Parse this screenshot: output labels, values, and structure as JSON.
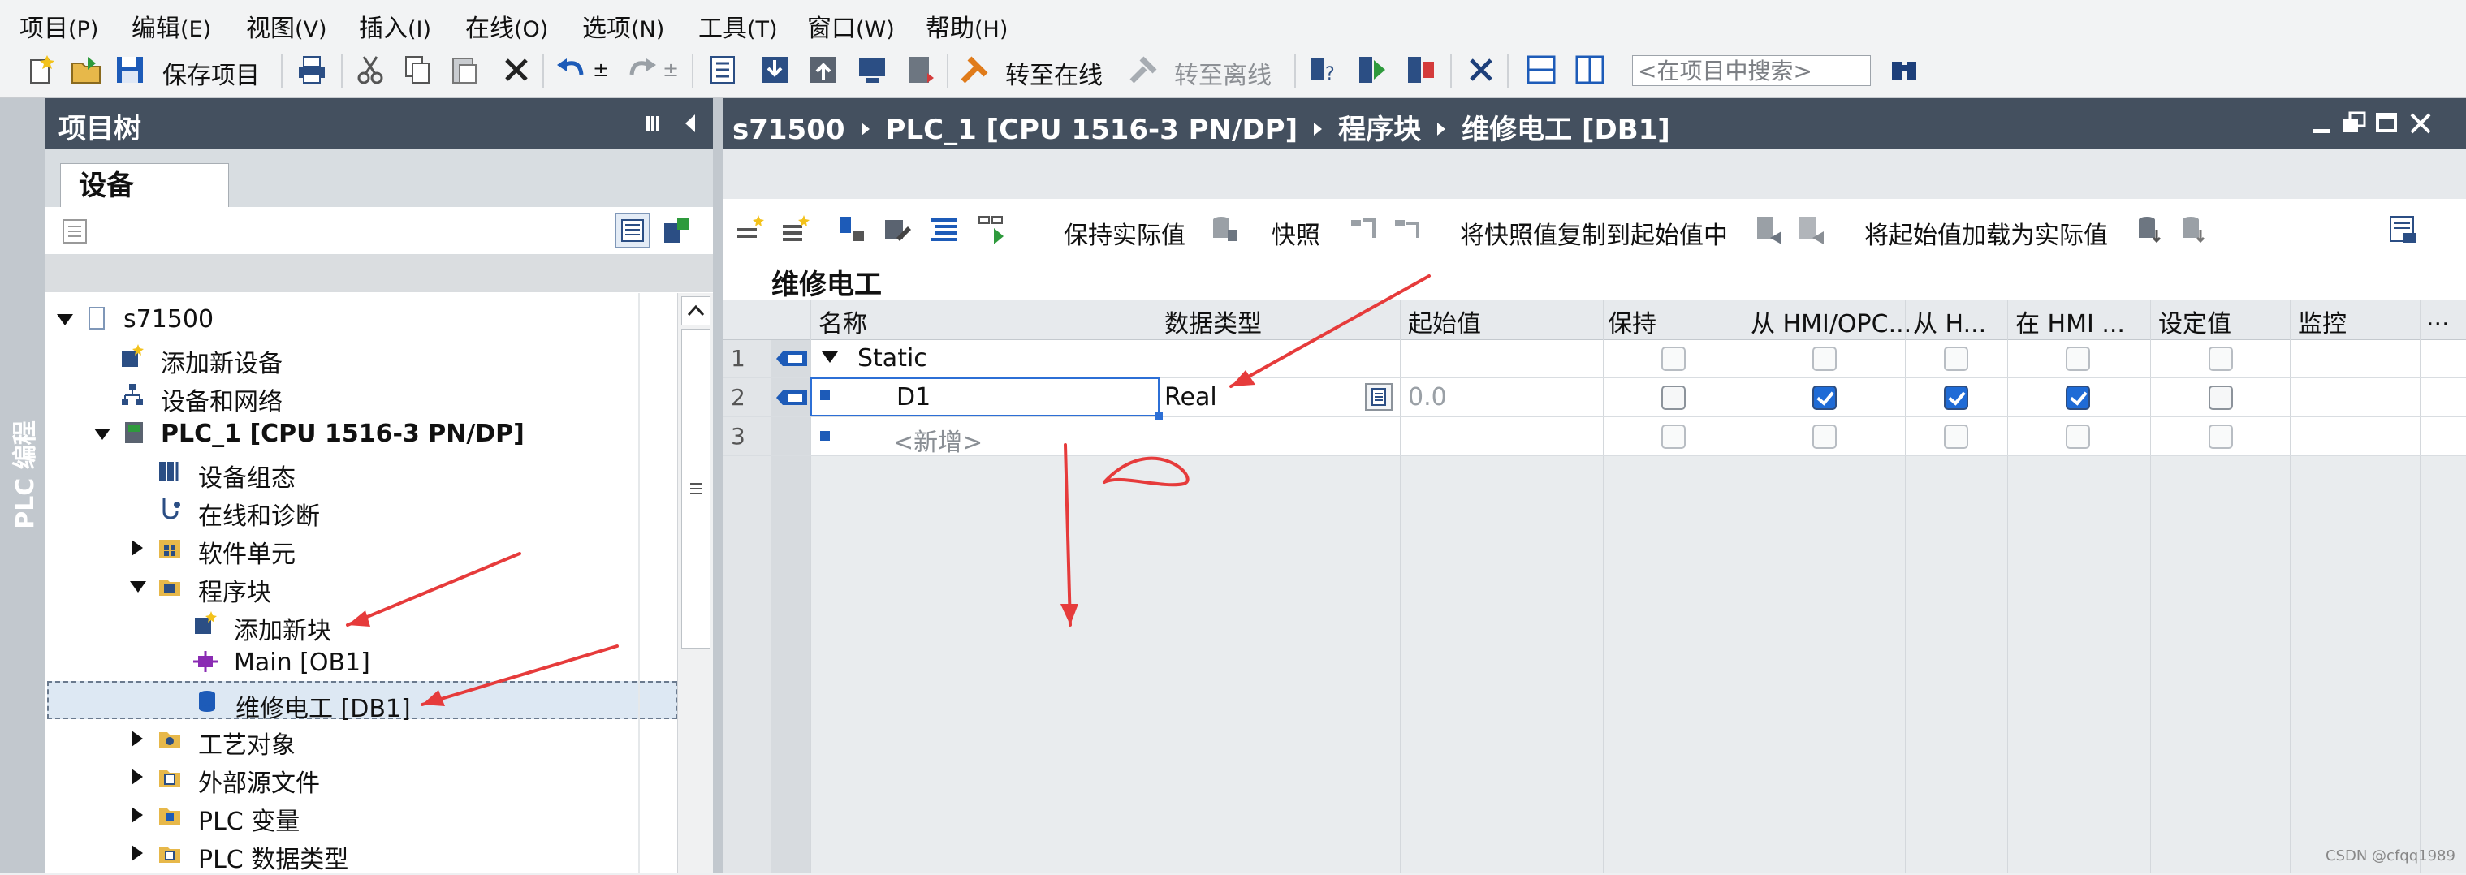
{
  "menubar": {
    "items": [
      {
        "label": "项目",
        "key": "(P)"
      },
      {
        "label": "编辑",
        "key": "(E)"
      },
      {
        "label": "视图",
        "key": "(V)"
      },
      {
        "label": "插入",
        "key": "(I)"
      },
      {
        "label": "在线",
        "key": "(O)"
      },
      {
        "label": "选项",
        "key": "(N)"
      },
      {
        "label": "工具",
        "key": "(T)"
      },
      {
        "label": "窗口",
        "key": "(W)"
      },
      {
        "label": "帮助",
        "key": "(H)"
      }
    ]
  },
  "toolbar": {
    "save_project": "保存项目",
    "go_online": "转至在线",
    "go_offline": "转至离线",
    "search_placeholder": "<在项目中搜索>"
  },
  "sidebar": {
    "rail_label": "PLC 编程"
  },
  "project_tree": {
    "title": "项目树",
    "tab": "设备",
    "items": [
      {
        "label": "s71500"
      },
      {
        "label": "添加新设备"
      },
      {
        "label": "设备和网络"
      },
      {
        "label": "PLC_1 [CPU 1516-3 PN/DP]"
      },
      {
        "label": "设备组态"
      },
      {
        "label": "在线和诊断"
      },
      {
        "label": "软件单元"
      },
      {
        "label": "程序块"
      },
      {
        "label": "添加新块"
      },
      {
        "label": "Main [OB1]"
      },
      {
        "label": "维修电工 [DB1]"
      },
      {
        "label": "工艺对象"
      },
      {
        "label": "外部源文件"
      },
      {
        "label": "PLC 变量"
      },
      {
        "label": "PLC 数据类型"
      }
    ]
  },
  "editor": {
    "breadcrumb": [
      "s71500",
      "PLC_1 [CPU 1516-3 PN/DP]",
      "程序块",
      "维修电工 [DB1]"
    ],
    "toolbar": {
      "keep_actual": "保持实际值",
      "snapshot": "快照",
      "copy_snapshot": "将快照值复制到起始值中",
      "load_start": "将起始值加载为实际值"
    },
    "block_title": "维修电工",
    "columns": [
      "名称",
      "数据类型",
      "起始值",
      "保持",
      "从 HMI/OPC...",
      "从 H...",
      "在 HMI ...",
      "设定值",
      "监控",
      "..."
    ],
    "rows": [
      {
        "num": "1",
        "name": "Static",
        "type": "",
        "start": "",
        "keep": false,
        "hmi_opc": false,
        "from_h": false,
        "in_hmi": false,
        "setpoint": false
      },
      {
        "num": "2",
        "name": "D1",
        "type": "Real",
        "start": "0.0",
        "keep": false,
        "hmi_opc": true,
        "from_h": true,
        "in_hmi": true,
        "setpoint": false
      },
      {
        "num": "3",
        "name": "<新增>",
        "type": "",
        "start": "",
        "keep": false,
        "hmi_opc": false,
        "from_h": false,
        "in_hmi": false,
        "setpoint": false
      }
    ]
  },
  "watermark": "CSDN @cfqq1989",
  "colors": {
    "header_bg": "#44505f",
    "rail_bg": "#c2c8ce",
    "check_blue": "#1f6bd6",
    "annotation_red": "#e63b3b"
  }
}
